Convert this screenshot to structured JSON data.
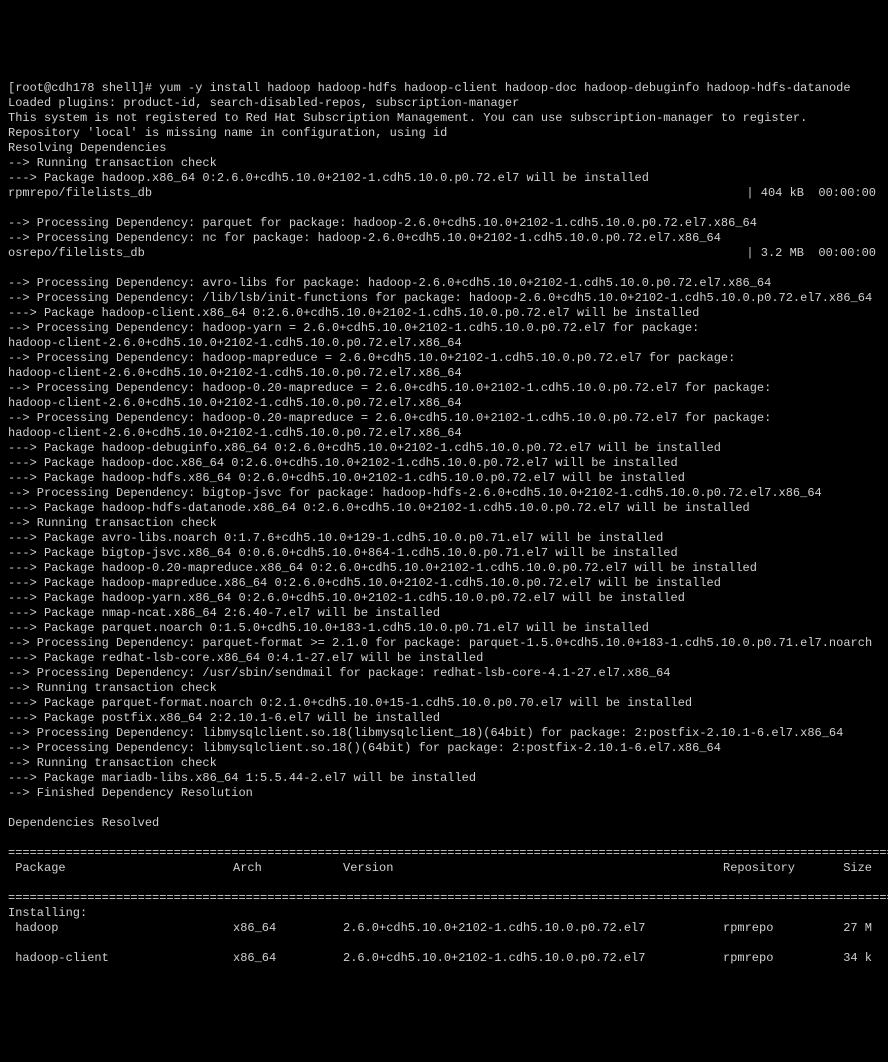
{
  "prompt": {
    "prefix": "[root@cdh178 shell]# ",
    "command": "yum -y install hadoop hadoop-hdfs hadoop-client hadoop-doc hadoop-debuginfo hadoop-hdfs-datanode"
  },
  "lines": [
    "Loaded plugins: product-id, search-disabled-repos, subscription-manager",
    "This system is not registered to Red Hat Subscription Management. You can use subscription-manager to register.",
    "Repository 'local' is missing name in configuration, using id",
    "Resolving Dependencies",
    "--> Running transaction check",
    "---> Package hadoop.x86_64 0:2.6.0+cdh5.10.0+2102-1.cdh5.10.0.p0.72.el7 will be installed"
  ],
  "dl1": {
    "left": "rpmrepo/filelists_db",
    "right": "| 404 kB  00:00:00"
  },
  "lines2": [
    "--> Processing Dependency: parquet for package: hadoop-2.6.0+cdh5.10.0+2102-1.cdh5.10.0.p0.72.el7.x86_64",
    "--> Processing Dependency: nc for package: hadoop-2.6.0+cdh5.10.0+2102-1.cdh5.10.0.p0.72.el7.x86_64"
  ],
  "dl2": {
    "left": "osrepo/filelists_db",
    "right": "| 3.2 MB  00:00:00"
  },
  "lines3": [
    "--> Processing Dependency: avro-libs for package: hadoop-2.6.0+cdh5.10.0+2102-1.cdh5.10.0.p0.72.el7.x86_64",
    "--> Processing Dependency: /lib/lsb/init-functions for package: hadoop-2.6.0+cdh5.10.0+2102-1.cdh5.10.0.p0.72.el7.x86_64",
    "---> Package hadoop-client.x86_64 0:2.6.0+cdh5.10.0+2102-1.cdh5.10.0.p0.72.el7 will be installed",
    "--> Processing Dependency: hadoop-yarn = 2.6.0+cdh5.10.0+2102-1.cdh5.10.0.p0.72.el7 for package: hadoop-client-2.6.0+cdh5.10.0+2102-1.cdh5.10.0.p0.72.el7.x86_64",
    "--> Processing Dependency: hadoop-mapreduce = 2.6.0+cdh5.10.0+2102-1.cdh5.10.0.p0.72.el7 for package: hadoop-client-2.6.0+cdh5.10.0+2102-1.cdh5.10.0.p0.72.el7.x86_64",
    "--> Processing Dependency: hadoop-0.20-mapreduce = 2.6.0+cdh5.10.0+2102-1.cdh5.10.0.p0.72.el7 for package: hadoop-client-2.6.0+cdh5.10.0+2102-1.cdh5.10.0.p0.72.el7.x86_64",
    "--> Processing Dependency: hadoop-0.20-mapreduce = 2.6.0+cdh5.10.0+2102-1.cdh5.10.0.p0.72.el7 for package: hadoop-client-2.6.0+cdh5.10.0+2102-1.cdh5.10.0.p0.72.el7.x86_64",
    "---> Package hadoop-debuginfo.x86_64 0:2.6.0+cdh5.10.0+2102-1.cdh5.10.0.p0.72.el7 will be installed",
    "---> Package hadoop-doc.x86_64 0:2.6.0+cdh5.10.0+2102-1.cdh5.10.0.p0.72.el7 will be installed",
    "---> Package hadoop-hdfs.x86_64 0:2.6.0+cdh5.10.0+2102-1.cdh5.10.0.p0.72.el7 will be installed",
    "--> Processing Dependency: bigtop-jsvc for package: hadoop-hdfs-2.6.0+cdh5.10.0+2102-1.cdh5.10.0.p0.72.el7.x86_64",
    "---> Package hadoop-hdfs-datanode.x86_64 0:2.6.0+cdh5.10.0+2102-1.cdh5.10.0.p0.72.el7 will be installed",
    "--> Running transaction check",
    "---> Package avro-libs.noarch 0:1.7.6+cdh5.10.0+129-1.cdh5.10.0.p0.71.el7 will be installed",
    "---> Package bigtop-jsvc.x86_64 0:0.6.0+cdh5.10.0+864-1.cdh5.10.0.p0.71.el7 will be installed",
    "---> Package hadoop-0.20-mapreduce.x86_64 0:2.6.0+cdh5.10.0+2102-1.cdh5.10.0.p0.72.el7 will be installed",
    "---> Package hadoop-mapreduce.x86_64 0:2.6.0+cdh5.10.0+2102-1.cdh5.10.0.p0.72.el7 will be installed",
    "---> Package hadoop-yarn.x86_64 0:2.6.0+cdh5.10.0+2102-1.cdh5.10.0.p0.72.el7 will be installed",
    "---> Package nmap-ncat.x86_64 2:6.40-7.el7 will be installed",
    "---> Package parquet.noarch 0:1.5.0+cdh5.10.0+183-1.cdh5.10.0.p0.71.el7 will be installed",
    "--> Processing Dependency: parquet-format >= 2.1.0 for package: parquet-1.5.0+cdh5.10.0+183-1.cdh5.10.0.p0.71.el7.noarch",
    "---> Package redhat-lsb-core.x86_64 0:4.1-27.el7 will be installed",
    "--> Processing Dependency: /usr/sbin/sendmail for package: redhat-lsb-core-4.1-27.el7.x86_64",
    "--> Running transaction check",
    "---> Package parquet-format.noarch 0:2.1.0+cdh5.10.0+15-1.cdh5.10.0.p0.70.el7 will be installed",
    "---> Package postfix.x86_64 2:2.10.1-6.el7 will be installed",
    "--> Processing Dependency: libmysqlclient.so.18(libmysqlclient_18)(64bit) for package: 2:postfix-2.10.1-6.el7.x86_64",
    "--> Processing Dependency: libmysqlclient.so.18()(64bit) for package: 2:postfix-2.10.1-6.el7.x86_64",
    "--> Running transaction check",
    "---> Package mariadb-libs.x86_64 1:5.5.44-2.el7 will be installed",
    "--> Finished Dependency Resolution",
    "",
    "Dependencies Resolved",
    ""
  ],
  "divider": "================================================================================================================================",
  "table": {
    "headers": {
      "c1": " Package",
      "c2": "Arch",
      "c3": "Version",
      "c4": "Repository",
      "c5": "Size"
    },
    "section": "Installing:",
    "rows": [
      {
        "c1": " hadoop",
        "c2": "x86_64",
        "c3": "2.6.0+cdh5.10.0+2102-1.cdh5.10.0.p0.72.el7",
        "c4": "rpmrepo",
        "c5": "27 M"
      },
      {
        "c1": " hadoop-client",
        "c2": "x86_64",
        "c3": "2.6.0+cdh5.10.0+2102-1.cdh5.10.0.p0.72.el7",
        "c4": "rpmrepo",
        "c5": "34 k"
      }
    ]
  }
}
